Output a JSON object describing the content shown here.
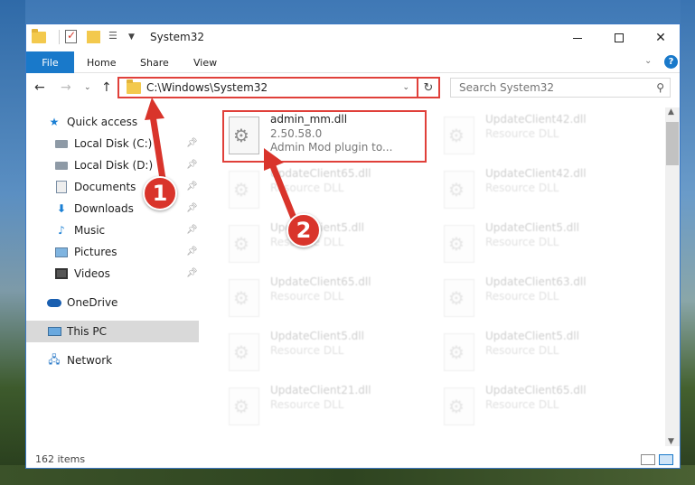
{
  "window": {
    "title": "System32"
  },
  "ribbon": {
    "tabs": [
      "File",
      "Home",
      "Share",
      "View"
    ]
  },
  "nav": {
    "address": "C:\\Windows\\System32",
    "search_placeholder": "Search System32"
  },
  "sidebar": {
    "quick_access": "Quick access",
    "items": [
      "Local Disk (C:)",
      "Local Disk (D:)",
      "Documents",
      "Downloads",
      "Music",
      "Pictures",
      "Videos"
    ],
    "onedrive": "OneDrive",
    "this_pc": "This PC",
    "network": "Network"
  },
  "files": {
    "selected": {
      "name": "admin_mm.dll",
      "version": "2.50.58.0",
      "description": "Admin Mod plugin to..."
    },
    "others": [
      {
        "name": "UpdateClient42.dll",
        "type": "Resource DLL"
      },
      {
        "name": "UpdateClient65.dll",
        "type": "Resource DLL"
      },
      {
        "name": "UpdateClient42.dll",
        "type": "Resource DLL"
      },
      {
        "name": "UpdateClient5.dll",
        "type": "Resource DLL"
      },
      {
        "name": "UpdateClient5.dll",
        "type": "Resource DLL"
      },
      {
        "name": "UpdateClient65.dll",
        "type": "Resource DLL"
      },
      {
        "name": "UpdateClient63.dll",
        "type": "Resource DLL"
      },
      {
        "name": "UpdateClient5.dll",
        "type": "Resource DLL"
      },
      {
        "name": "UpdateClient5.dll",
        "type": "Resource DLL"
      },
      {
        "name": "UpdateClient21.dll",
        "type": "Resource DLL"
      },
      {
        "name": "UpdateClient65.dll",
        "type": "Resource DLL"
      }
    ]
  },
  "status": {
    "items": "162 items"
  },
  "annotations": {
    "step1": "1",
    "step2": "2",
    "color": "#d9342b"
  }
}
